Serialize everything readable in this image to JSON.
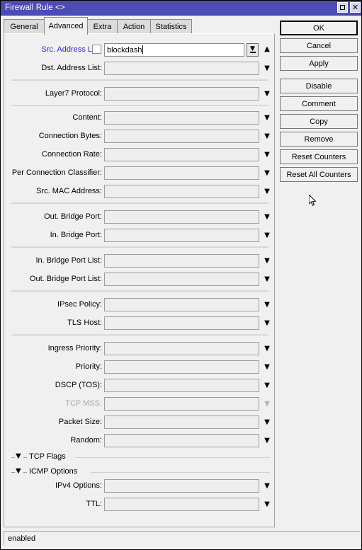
{
  "window": {
    "title": "Firewall Rule <>",
    "maximize_icon": "maximize-icon",
    "close_icon": "close-icon"
  },
  "tabs": [
    {
      "label": "General",
      "active": false
    },
    {
      "label": "Advanced",
      "active": true
    },
    {
      "label": "Extra",
      "active": false
    },
    {
      "label": "Action",
      "active": false
    },
    {
      "label": "Statistics",
      "active": false
    }
  ],
  "form": {
    "rows": [
      {
        "label": "Src. Address List:",
        "value": "blockdash",
        "placeholder": "",
        "state": "blue",
        "checkbox": true,
        "dropdown_button": true,
        "arrow": "up"
      },
      {
        "label": "Dst. Address List:",
        "value": "",
        "placeholder": "",
        "state": "normal",
        "checkbox": false,
        "dropdown_button": false,
        "arrow": "down"
      },
      {
        "label": "Layer7 Protocol:",
        "value": "",
        "placeholder": "",
        "state": "normal",
        "checkbox": false,
        "dropdown_button": false,
        "arrow": "down"
      },
      {
        "label": "Content:",
        "value": "",
        "placeholder": "",
        "state": "normal",
        "checkbox": false,
        "dropdown_button": false,
        "arrow": "down"
      },
      {
        "label": "Connection Bytes:",
        "value": "",
        "placeholder": "",
        "state": "normal",
        "checkbox": false,
        "dropdown_button": false,
        "arrow": "down"
      },
      {
        "label": "Connection Rate:",
        "value": "",
        "placeholder": "",
        "state": "normal",
        "checkbox": false,
        "dropdown_button": false,
        "arrow": "down"
      },
      {
        "label": "Per Connection Classifier:",
        "value": "",
        "placeholder": "",
        "state": "normal",
        "checkbox": false,
        "dropdown_button": false,
        "arrow": "down"
      },
      {
        "label": "Src. MAC Address:",
        "value": "",
        "placeholder": "",
        "state": "normal",
        "checkbox": false,
        "dropdown_button": false,
        "arrow": "down"
      },
      {
        "label": "Out. Bridge Port:",
        "value": "",
        "placeholder": "",
        "state": "normal",
        "checkbox": false,
        "dropdown_button": false,
        "arrow": "down"
      },
      {
        "label": "In. Bridge Port:",
        "value": "",
        "placeholder": "",
        "state": "normal",
        "checkbox": false,
        "dropdown_button": false,
        "arrow": "down"
      },
      {
        "label": "In. Bridge Port List:",
        "value": "",
        "placeholder": "",
        "state": "normal",
        "checkbox": false,
        "dropdown_button": false,
        "arrow": "down"
      },
      {
        "label": "Out. Bridge Port List:",
        "value": "",
        "placeholder": "",
        "state": "normal",
        "checkbox": false,
        "dropdown_button": false,
        "arrow": "down"
      },
      {
        "label": "IPsec Policy:",
        "value": "",
        "placeholder": "",
        "state": "normal",
        "checkbox": false,
        "dropdown_button": false,
        "arrow": "down"
      },
      {
        "label": "TLS Host:",
        "value": "",
        "placeholder": "",
        "state": "normal",
        "checkbox": false,
        "dropdown_button": false,
        "arrow": "down"
      },
      {
        "label": "Ingress Priority:",
        "value": "",
        "placeholder": "",
        "state": "normal",
        "checkbox": false,
        "dropdown_button": false,
        "arrow": "down"
      },
      {
        "label": "Priority:",
        "value": "",
        "placeholder": "",
        "state": "normal",
        "checkbox": false,
        "dropdown_button": false,
        "arrow": "down"
      },
      {
        "label": "DSCP (TOS):",
        "value": "",
        "placeholder": "",
        "state": "normal",
        "checkbox": false,
        "dropdown_button": false,
        "arrow": "down"
      },
      {
        "label": "TCP MSS:",
        "value": "",
        "placeholder": "",
        "state": "disabled",
        "checkbox": false,
        "dropdown_button": false,
        "arrow": "down"
      },
      {
        "label": "Packet Size:",
        "value": "",
        "placeholder": "",
        "state": "normal",
        "checkbox": false,
        "dropdown_button": false,
        "arrow": "down"
      },
      {
        "label": "Random:",
        "value": "",
        "placeholder": "",
        "state": "normal",
        "checkbox": false,
        "dropdown_button": false,
        "arrow": "down"
      },
      {
        "label": "IPv4 Options:",
        "value": "",
        "placeholder": "",
        "state": "normal",
        "checkbox": false,
        "dropdown_button": false,
        "arrow": "down"
      },
      {
        "label": "TTL:",
        "value": "",
        "placeholder": "",
        "state": "normal",
        "checkbox": false,
        "dropdown_button": false,
        "arrow": "down"
      }
    ],
    "groups": [
      {
        "label": "TCP Flags",
        "expander_icon": "chevron-down-icon"
      },
      {
        "label": "ICMP Options",
        "expander_icon": "chevron-down-icon"
      }
    ]
  },
  "buttons": [
    {
      "label": "OK",
      "default": true
    },
    {
      "label": "Cancel",
      "default": false
    },
    {
      "label": "Apply",
      "default": false
    },
    {
      "label": "Disable",
      "default": false
    },
    {
      "label": "Comment",
      "default": false
    },
    {
      "label": "Copy",
      "default": false
    },
    {
      "label": "Remove",
      "default": false
    },
    {
      "label": "Reset Counters",
      "default": false
    },
    {
      "label": "Reset All Counters",
      "default": false
    }
  ],
  "statusbar": {
    "text": "enabled"
  },
  "colors": {
    "titlebar": "#4c4cb4",
    "accent_label": "#2b2bc8",
    "window_bg": "#f0f0f0",
    "disabled_text": "#a8a8a8"
  }
}
